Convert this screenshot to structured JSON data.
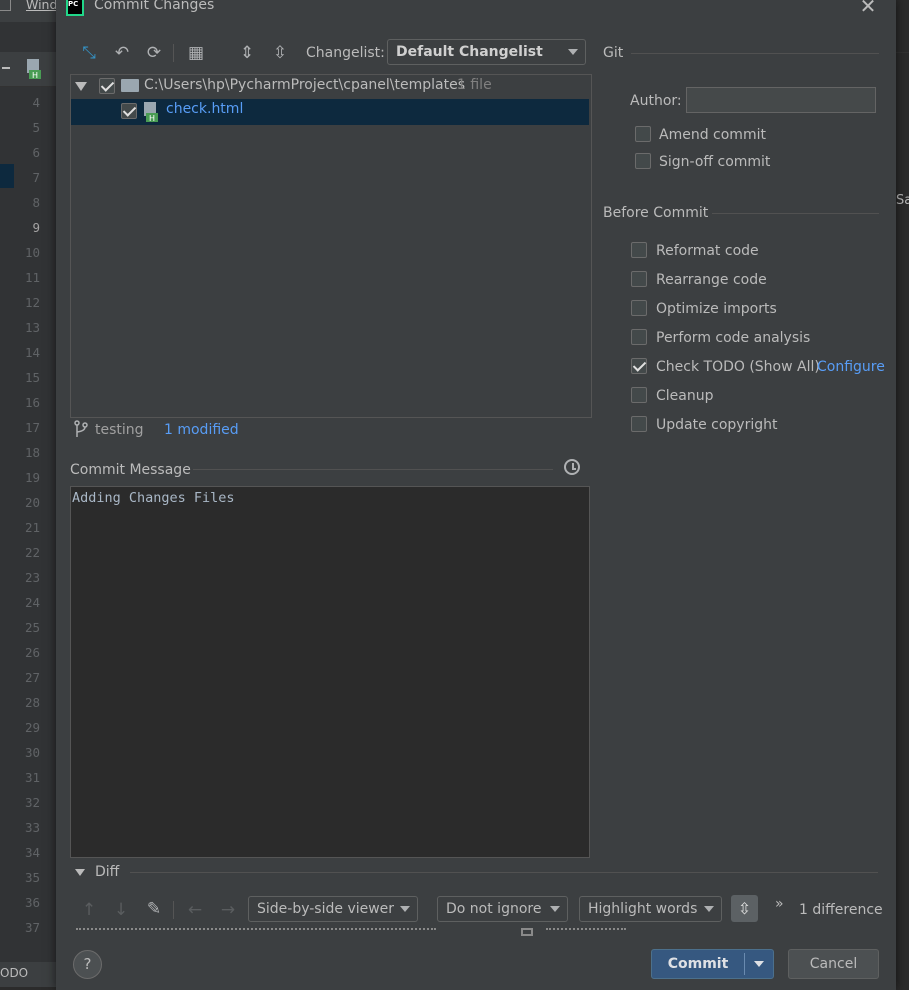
{
  "ide": {
    "menu_fragment": "Wind",
    "line_numbers": [
      "4",
      "5",
      "6",
      "7",
      "8",
      "9",
      "10",
      "11",
      "12",
      "13",
      "14",
      "15",
      "16",
      "17",
      "18",
      "19",
      "20",
      "21",
      "22",
      "23",
      "24",
      "25",
      "26",
      "27",
      "28",
      "29",
      "30",
      "31",
      "32",
      "33",
      "34",
      "35",
      "36",
      "37"
    ],
    "current_line": "9",
    "bottom_tool": "ODO",
    "right_fragment": "Sa"
  },
  "dialog": {
    "title": "Commit Changes",
    "app_icon": "pycharm-logo-icon",
    "toolbar": {
      "changelist_label": "Changelist:",
      "changelist_value": "Default Changelist"
    },
    "tree": {
      "root_path": "C:\\Users\\hp\\PycharmProject\\cpanel\\templates",
      "root_count": "1 file",
      "file_name": "check.html"
    },
    "status": {
      "branch": "testing",
      "modified": "1 modified"
    },
    "commit_message": {
      "label": "Commit Message",
      "text": "Adding Changes Files"
    },
    "git": {
      "section": "Git",
      "author_label": "Author:",
      "author_value": "",
      "amend": "Amend commit",
      "signoff": "Sign-off commit"
    },
    "before_commit": {
      "section": "Before Commit",
      "options": [
        {
          "label": "Reformat code",
          "checked": false
        },
        {
          "label": "Rearrange code",
          "checked": false
        },
        {
          "label": "Optimize imports",
          "checked": false
        },
        {
          "label": "Perform code analysis",
          "checked": false
        },
        {
          "label": "Check TODO (Show All)",
          "checked": true
        },
        {
          "label": "Cleanup",
          "checked": false
        },
        {
          "label": "Update copyright",
          "checked": false
        }
      ],
      "configure_link": "Configure"
    },
    "diff": {
      "label": "Diff",
      "viewer": "Side-by-side viewer",
      "ignore": "Do not ignore",
      "highlight": "Highlight words",
      "differences": "1 difference"
    },
    "buttons": {
      "help": "?",
      "commit": "Commit",
      "cancel": "Cancel"
    },
    "colors": {
      "background": "#3c3f41",
      "accent": "#589df6",
      "commit_button": "#365880",
      "selection": "#0d293e"
    }
  }
}
